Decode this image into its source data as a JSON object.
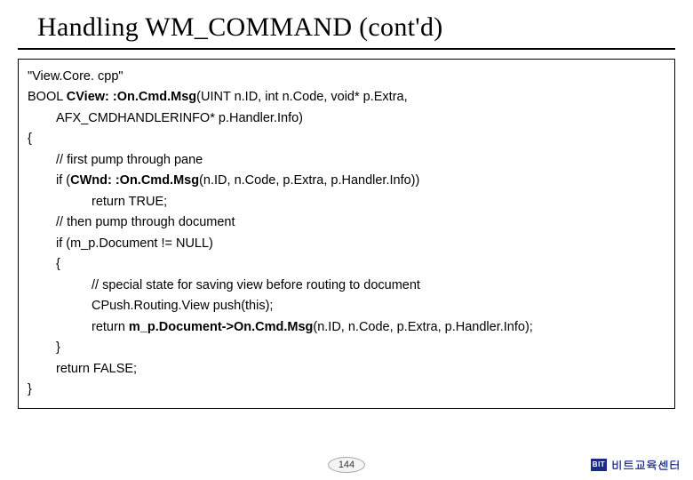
{
  "title": "Handling WM_COMMAND (cont'd)",
  "code": {
    "l1": "\"View.Core. cpp\"",
    "l2a": "BOOL ",
    "l2b": "CView: :On.Cmd.Msg",
    "l2c": "(UINT n.ID, int n.Code, void* p.Extra,",
    "l3": "AFX_CMDHANDLERINFO* p.Handler.Info)",
    "l4": "{",
    "l5": "// first pump through pane",
    "l6a": "if (",
    "l6b": "CWnd: :On.Cmd.Msg",
    "l6c": "(n.ID, n.Code, p.Extra, p.Handler.Info))",
    "l7": "return TRUE;",
    "l8": "// then pump through document",
    "l9": "if (m_p.Document != NULL)",
    "l10": "{",
    "l11": "// special state for saving view before routing to document",
    "l12": "CPush.Routing.View push(this);",
    "l13a": "return ",
    "l13b": "m_p.Document->On.Cmd.Msg",
    "l13c": "(n.ID, n.Code, p.Extra, p.Handler.Info);",
    "l14": "}",
    "l15": "return FALSE;",
    "l16": "}"
  },
  "footer": {
    "page": "144",
    "logo": "BIT",
    "brand": "비트교육센터"
  }
}
